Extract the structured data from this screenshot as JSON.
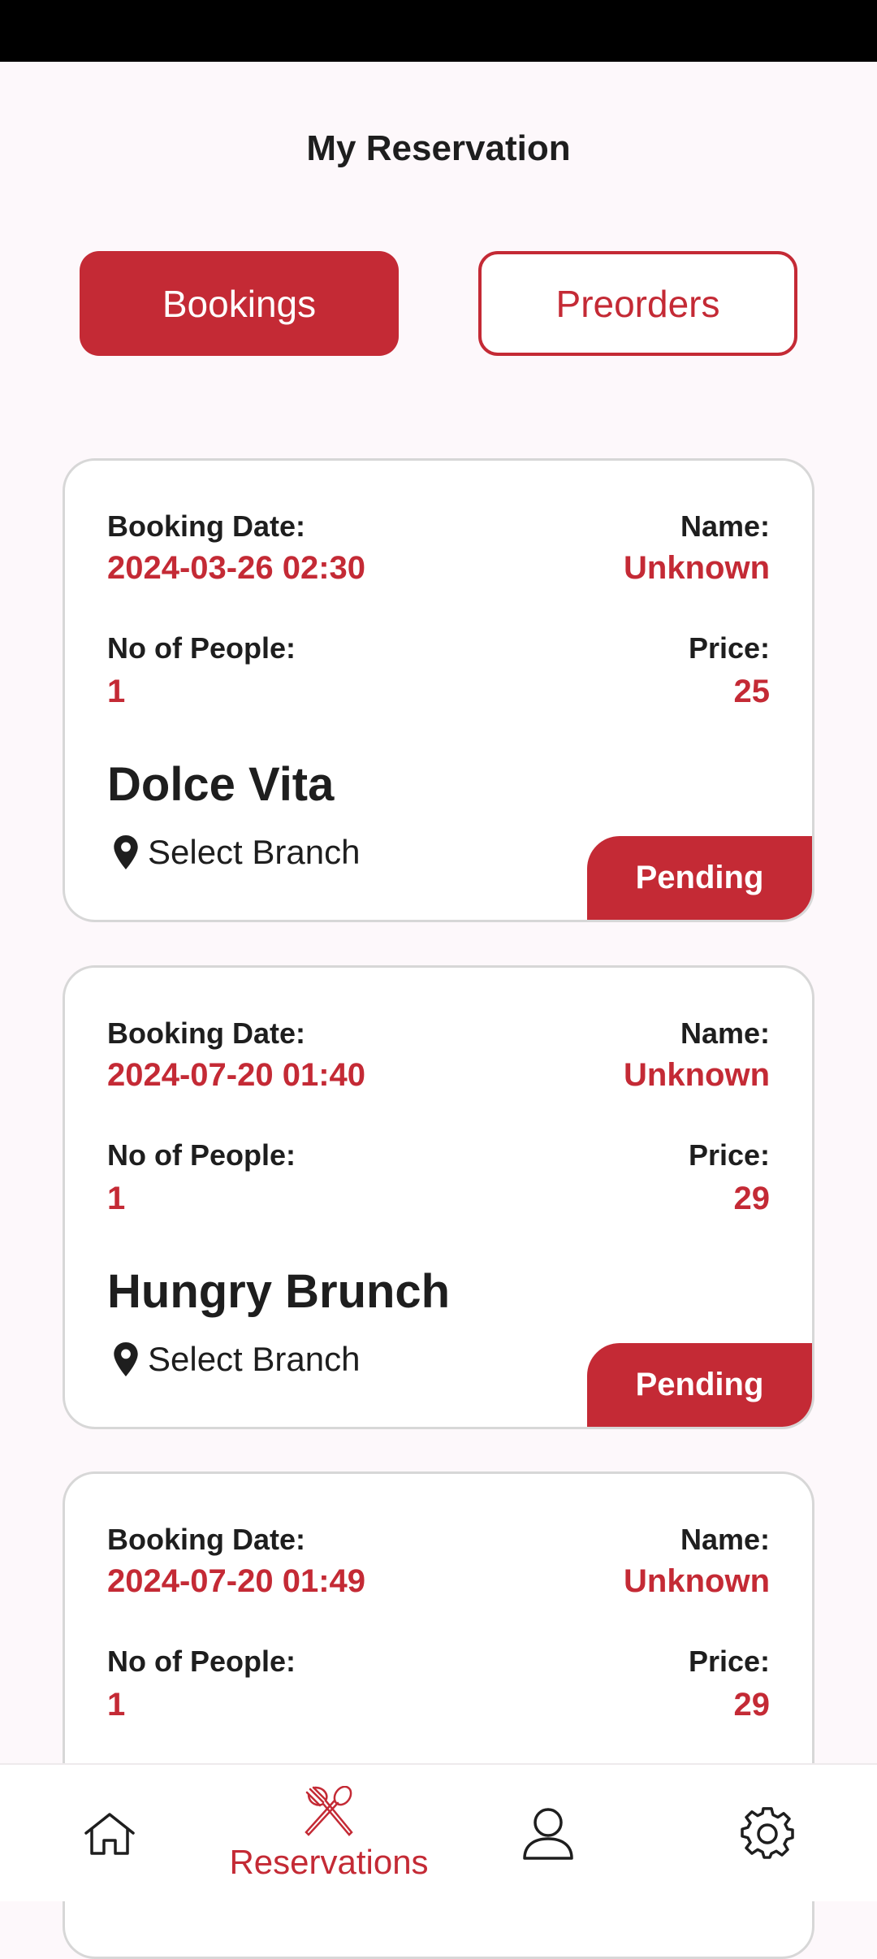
{
  "header": {
    "title": "My Reservation"
  },
  "tabs": {
    "bookings": "Bookings",
    "preorders": "Preorders",
    "active": "Bookings"
  },
  "labels": {
    "booking_date": "Booking Date:",
    "name": "Name:",
    "people": "No of People:",
    "price": "Price:"
  },
  "reservations": [
    {
      "date": "2024-03-26 02:30",
      "name": "Unknown",
      "people": "1",
      "price": "25",
      "restaurant": "Dolce Vita",
      "branch": "Select Branch",
      "status": "Pending"
    },
    {
      "date": "2024-07-20 01:40",
      "name": "Unknown",
      "people": "1",
      "price": "29",
      "restaurant": "Hungry Brunch",
      "branch": "Select Branch",
      "status": "Pending"
    },
    {
      "date": "2024-07-20 01:49",
      "name": "Unknown",
      "people": "1",
      "price": "29"
    }
  ],
  "nav": {
    "items": [
      {
        "icon": "home-icon"
      },
      {
        "icon": "fork-spoon-icon",
        "label": "Reservations",
        "active": true
      },
      {
        "icon": "user-icon"
      },
      {
        "icon": "gear-icon"
      }
    ]
  },
  "colors": {
    "accent": "#c42a35",
    "background": "#fdf8fb",
    "text": "#1e1e1e"
  }
}
